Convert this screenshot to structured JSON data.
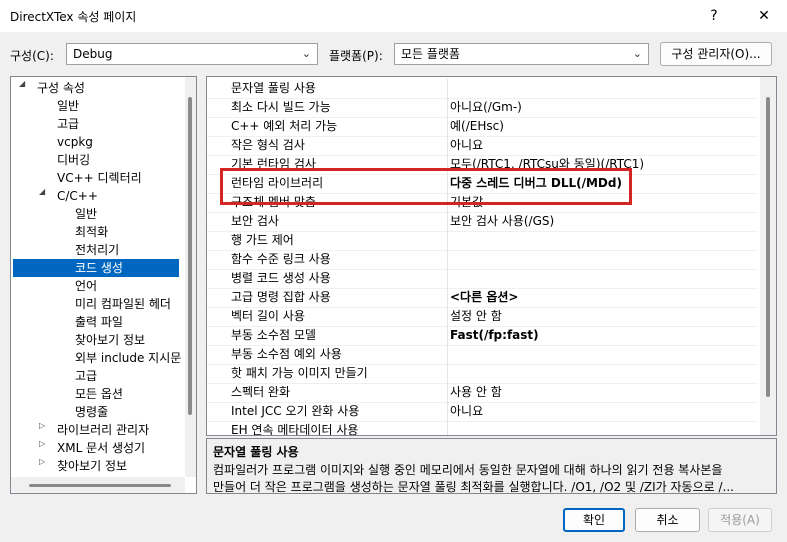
{
  "window": {
    "title": "DirectXTex 속성 페이지",
    "help_glyph": "?",
    "close_glyph": "✕"
  },
  "config_bar": {
    "config_label": "구성(C):",
    "config_value": "Debug",
    "platform_label": "플랫폼(P):",
    "platform_value": "모든 플랫폼",
    "manager_button": "구성 관리자(O)..."
  },
  "tree": [
    {
      "label": "구성 속성",
      "level": 0,
      "expand": "open"
    },
    {
      "label": "일반",
      "level": 1
    },
    {
      "label": "고급",
      "level": 1
    },
    {
      "label": "vcpkg",
      "level": 1
    },
    {
      "label": "디버깅",
      "level": 1
    },
    {
      "label": "VC++ 디렉터리",
      "level": 1
    },
    {
      "label": "C/C++",
      "level": 1,
      "expand": "open"
    },
    {
      "label": "일반",
      "level": 2
    },
    {
      "label": "최적화",
      "level": 2
    },
    {
      "label": "전처리기",
      "level": 2
    },
    {
      "label": "코드 생성",
      "level": 2,
      "selected": true
    },
    {
      "label": "언어",
      "level": 2
    },
    {
      "label": "미리 컴파일된 헤더",
      "level": 2
    },
    {
      "label": "출력 파일",
      "level": 2
    },
    {
      "label": "찾아보기 정보",
      "level": 2
    },
    {
      "label": "외부 include 지시문",
      "level": 2
    },
    {
      "label": "고급",
      "level": 2
    },
    {
      "label": "모든 옵션",
      "level": 2
    },
    {
      "label": "명령줄",
      "level": 2
    },
    {
      "label": "라이브러리 관리자",
      "level": 1,
      "expand": "closed"
    },
    {
      "label": "XML 문서 생성기",
      "level": 1,
      "expand": "closed"
    },
    {
      "label": "찾아보기 정보",
      "level": 1,
      "expand": "closed"
    }
  ],
  "properties": [
    {
      "name": "문자열 풀링 사용",
      "value": ""
    },
    {
      "name": "최소 다시 빌드 가능",
      "value": "아니요(/Gm-)"
    },
    {
      "name": "C++ 예외 처리 가능",
      "value": "예(/EHsc)"
    },
    {
      "name": "작은 형식 검사",
      "value": "아니요"
    },
    {
      "name": "기본 런타임 검사",
      "value": "모두(/RTC1, /RTCsu와 동일)(/RTC1)"
    },
    {
      "name": "런타임 라이브러리",
      "value": "다중 스레드 디버그 DLL(/MDd)",
      "bold": true
    },
    {
      "name": "구조체 멤버 맞춤",
      "value": "기본값"
    },
    {
      "name": "보안 검사",
      "value": "보안 검사 사용(/GS)"
    },
    {
      "name": "행 가드 제어",
      "value": ""
    },
    {
      "name": "함수 수준 링크 사용",
      "value": ""
    },
    {
      "name": "병렬 코드 생성 사용",
      "value": ""
    },
    {
      "name": "고급 명령 집합 사용",
      "value": "<다른 옵션>",
      "bold": true
    },
    {
      "name": "벡터 길이 사용",
      "value": "설정 안 함"
    },
    {
      "name": "부동 소수점 모델",
      "value": "Fast(/fp:fast)",
      "bold": true
    },
    {
      "name": "부동 소수점 예외 사용",
      "value": ""
    },
    {
      "name": "핫 패치 가능 이미지 만들기",
      "value": ""
    },
    {
      "name": "스펙터 완화",
      "value": "사용 안 함"
    },
    {
      "name": "Intel JCC 오기 완화 사용",
      "value": "아니요"
    },
    {
      "name": "EH 연속 메타데이터 사용",
      "value": ""
    }
  ],
  "description": {
    "title": "문자열 풀링 사용",
    "line1": "컴파일러가 프로그램 이미지와 실행 중인 메모리에서 동일한 문자열에 대해 하나의 읽기 전용 복사본을",
    "line2": "만들어 더 작은 프로그램을 생성하는 문자열 풀링 최적화를 실행합니다. /O1, /O2 및 /ZI가 자동으로 /..."
  },
  "footer": {
    "ok": "확인",
    "cancel": "취소",
    "apply": "적용(A)"
  },
  "highlight_color": "#d42525",
  "selection_color": "#0067c0"
}
